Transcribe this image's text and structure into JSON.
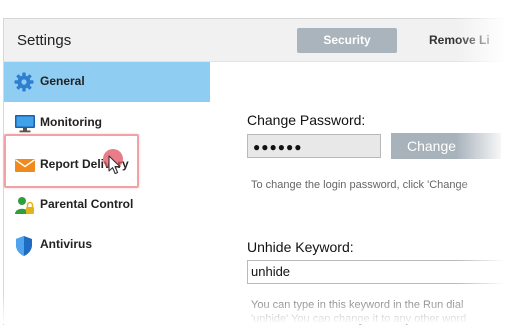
{
  "app": {
    "title": "Settings"
  },
  "tabs": [
    {
      "label": "Security",
      "active": true
    },
    {
      "label": "Remove Li"
    }
  ],
  "sidebar": {
    "items": [
      {
        "label": "General",
        "icon": "gear-icon",
        "selected": true
      },
      {
        "label": "Monitoring",
        "icon": "monitor-icon"
      },
      {
        "label": "Report Delivery",
        "icon": "envelope-icon"
      },
      {
        "label": "Parental Control",
        "icon": "user-lock-icon"
      },
      {
        "label": "Antivirus",
        "icon": "shield-icon"
      }
    ]
  },
  "password": {
    "heading": "Change Password:",
    "masked_value": "●●●●●●",
    "change_label": "Change",
    "help": "To change the login password, click 'Change"
  },
  "keyword": {
    "heading": "Unhide Keyword:",
    "value": "unhide",
    "help_line1": "You can type in this keyword in the Run dial",
    "help_line2": "'unhide' You can change it to any other word"
  },
  "colors": {
    "selected_bg": "#90cdf2",
    "tab_active_bg": "#aab4bc",
    "button_bg": "#a8b2bb",
    "highlight": "#f0a2a8"
  }
}
